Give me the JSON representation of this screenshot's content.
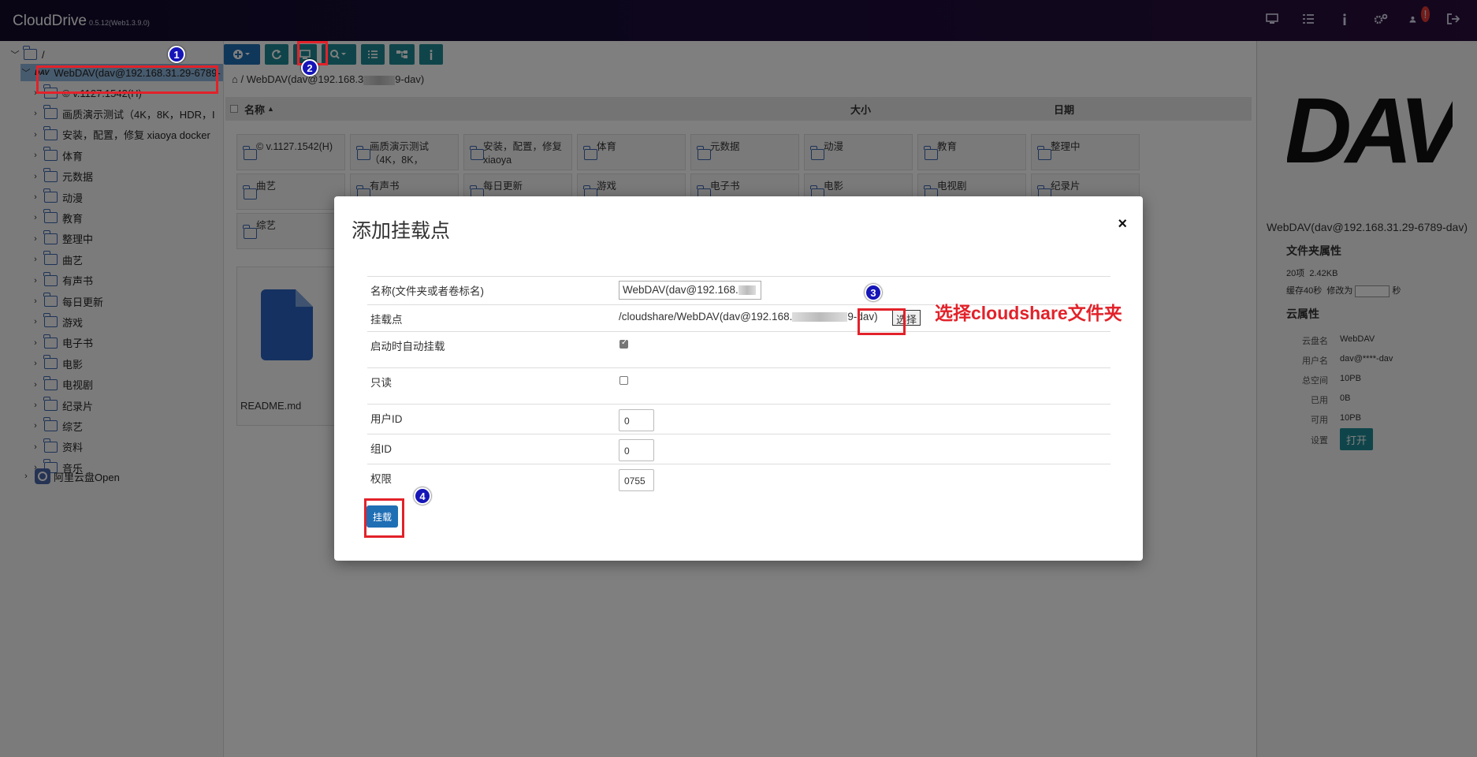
{
  "app": {
    "name": "CloudDrive",
    "version": "0.5.12(Web1.3.9.0)"
  },
  "top_icons": [
    "monitor-icon",
    "tasks-icon",
    "info-icon",
    "settings-icon",
    "user-icon",
    "logout-icon"
  ],
  "top_badge": "!",
  "tree": {
    "root": "/",
    "selected": "WebDAV(dav@192.168.31.29-6789-",
    "children": [
      "© v.1127.1542(H)",
      "画质演示测试（4K，8K，HDR，I",
      "安装，配置，修复 xiaoya docker",
      "体育",
      "元数据",
      "动漫",
      "教育",
      "整理中",
      "曲艺",
      "有声书",
      "每日更新",
      "游戏",
      "电子书",
      "电影",
      "电视剧",
      "纪录片",
      "综艺",
      "资料",
      "音乐"
    ],
    "other": "阿里云盘Open"
  },
  "breadcrumb": "WebDAV(dav@192.168.3",
  "breadcrumb_tail": "9-dav)",
  "list_header": {
    "name": "名称",
    "size": "大小",
    "date": "日期"
  },
  "tiles": [
    "© v.1127.1542(H)",
    "画质演示测试（4K，8K，",
    "安装，配置，修复 xiaoya",
    "体育",
    "元数据",
    "动漫",
    "教育",
    "整理中",
    "曲艺",
    "有声书",
    "每日更新",
    "游戏",
    "电子书",
    "电影",
    "电视剧",
    "纪录片",
    "综艺"
  ],
  "readme": "README.md",
  "right_panel": {
    "logo": "DAV",
    "title": "WebDAV(dav@192.168.31.29-6789-dav)",
    "folder_props": "文件夹属性",
    "items_count": "20项",
    "items_size": "2.42KB",
    "cache_label": "缓存40秒",
    "modify_label": "修改为",
    "sec_label": "秒",
    "cloud_props": "云属性",
    "rows": [
      {
        "label": "云盘名",
        "value": "WebDAV"
      },
      {
        "label": "用户名",
        "value": "dav@****-dav"
      },
      {
        "label": "总空间",
        "value": "10PB"
      },
      {
        "label": "已用",
        "value": "0B"
      },
      {
        "label": "可用",
        "value": "10PB"
      }
    ],
    "settings_label": "设置",
    "open_label": "打开"
  },
  "modal": {
    "title": "添加挂载点",
    "close": "×",
    "name_label": "名称(文件夹或者卷标名)",
    "name_value": "WebDAV(dav@192.168.",
    "mount_label": "挂载点",
    "mount_value": "/cloudshare/WebDAV(dav@192.168.",
    "mount_tail": "9-dav)",
    "choose_label": "选择",
    "auto_label": "启动时自动挂载",
    "auto_checked": true,
    "readonly_label": "只读",
    "readonly_checked": false,
    "uid_label": "用户ID",
    "uid_value": "0",
    "gid_label": "组ID",
    "gid_value": "0",
    "perm_label": "权限",
    "perm_value": "0755",
    "mount_button": "挂载"
  },
  "annotation": {
    "steps": [
      "1",
      "2",
      "3",
      "4"
    ],
    "note": "选择cloudshare文件夹"
  }
}
